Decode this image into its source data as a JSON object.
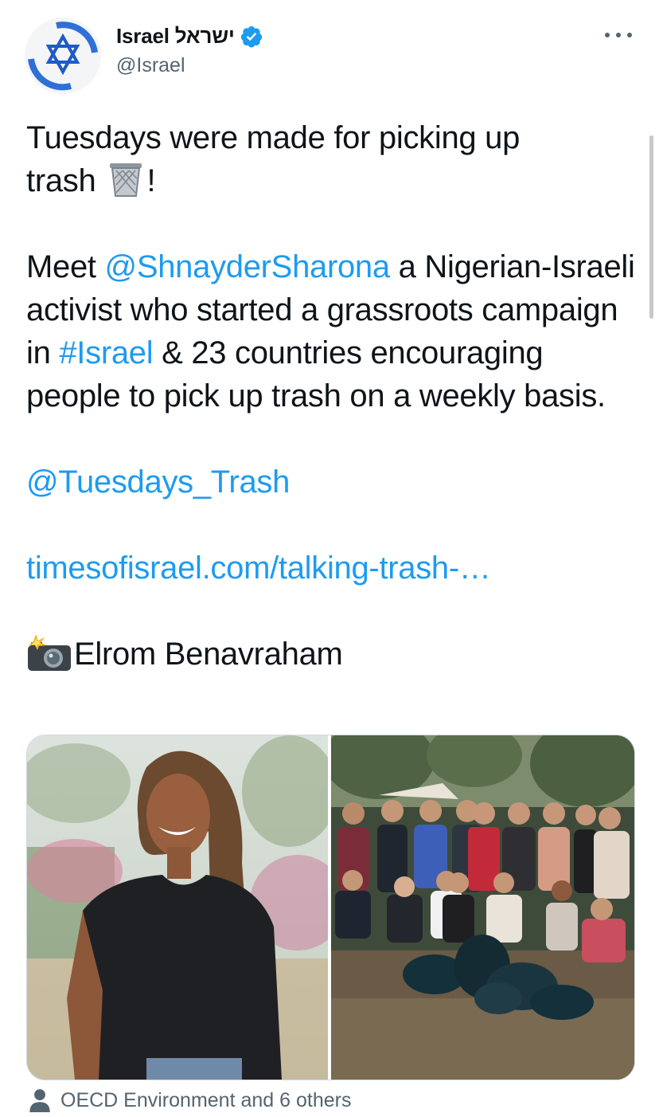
{
  "author": {
    "name": "Israel ישראל",
    "handle": "@Israel",
    "avatar_icon": "star-of-david-icon",
    "verified": true,
    "accent": "#1d9bf0"
  },
  "tweet": {
    "line1": "Tuesdays were made for picking up",
    "line2_text": "trash",
    "line2_emoji": "wastebasket-emoji",
    "line2_end": "!",
    "para2_prefix": "Meet ",
    "para2_mention": "@ShnayderSharona",
    "para2_mid": " a Nigerian-Israeli activist who started a grassroots campaign in ",
    "para2_hashtag": "#Israel",
    "para2_suffix": " & 23 countries encouraging people to pick up trash on a weekly basis.",
    "mention2": "@Tuesdays_Trash",
    "link": "timesofisrael.com/talking-trash-…",
    "credit_emoji": "camera-with-flash-emoji",
    "credit": "Elrom Benavraham"
  },
  "media": [
    {
      "alt_icon": "portrait-photo",
      "description": "woman in black t-shirt smiling"
    },
    {
      "alt_icon": "group-photo",
      "description": "group of volunteers with trash bags in park"
    }
  ],
  "tagged": {
    "icon": "person-icon",
    "text": "OECD Environment and 6 others"
  }
}
